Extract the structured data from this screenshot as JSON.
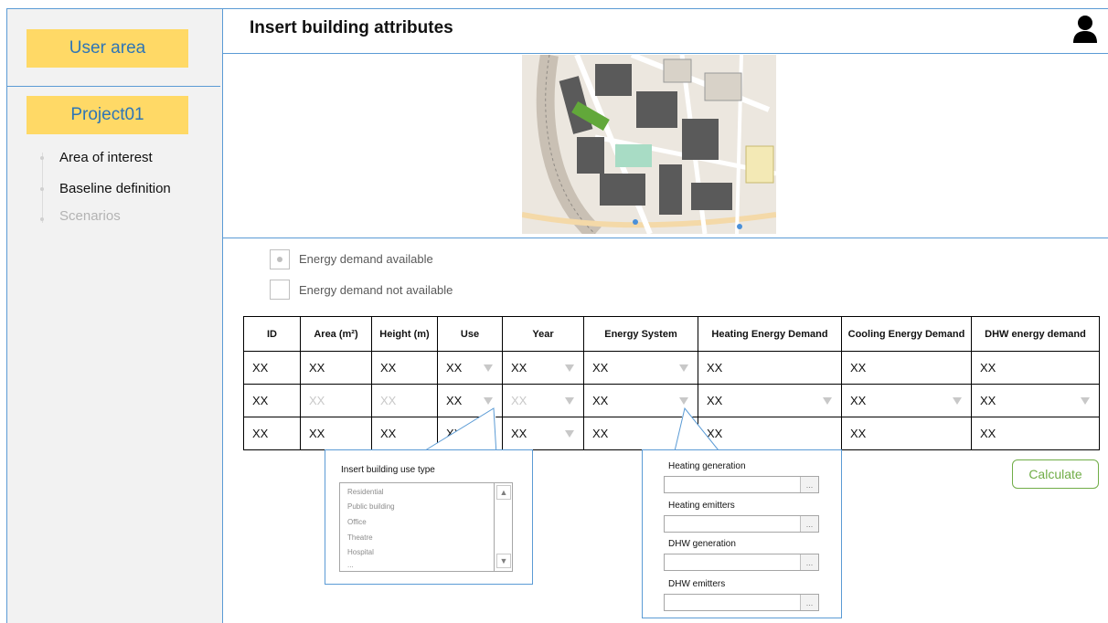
{
  "sidebar": {
    "user_area": "User area",
    "project": "Project01",
    "steps": [
      {
        "label": "Area of interest"
      },
      {
        "label": "Baseline definition"
      },
      {
        "label": "Scenarios"
      }
    ]
  },
  "header": {
    "title": "Insert building attributes",
    "user_icon": "user-icon"
  },
  "options": {
    "available": "Energy demand available",
    "not_available": "Energy demand not available",
    "selected": "available"
  },
  "table": {
    "headers": [
      "ID",
      "Area (m²)",
      "Height (m)",
      "Use",
      "Year",
      "Energy System",
      "Heating Energy Demand",
      "Cooling Energy Demand",
      "DHW energy demand"
    ],
    "rows": [
      [
        "XX",
        "XX",
        "XX",
        "XX",
        "XX",
        "XX",
        "XX",
        "XX",
        "XX"
      ],
      [
        "XX",
        "XX",
        "XX",
        "XX",
        "XX",
        "XX",
        "XX",
        "XX",
        "XX"
      ],
      [
        "XX",
        "XX",
        "XX",
        "XX",
        "XX",
        "XX",
        "XX",
        "XX",
        "XX"
      ]
    ]
  },
  "use_popup": {
    "title": "Insert building use type",
    "items": [
      "Residential",
      "Public building",
      "Office",
      "Theatre",
      "Hospital",
      "..."
    ]
  },
  "system_popup": {
    "fields": [
      "Heating generation",
      "Heating emitters",
      "DHW generation",
      "DHW emitters"
    ],
    "browse": "..."
  },
  "calculate_label": "Calculate",
  "colors": {
    "accent_blue": "#5b9bd5",
    "highlight_yellow": "#ffd966",
    "calc_green": "#70ad47"
  }
}
